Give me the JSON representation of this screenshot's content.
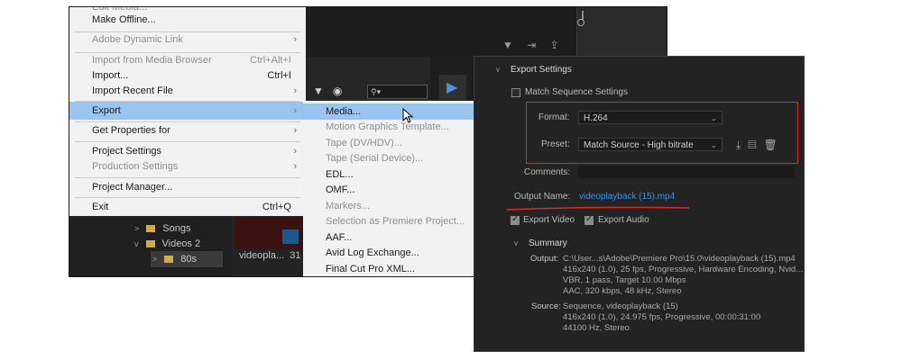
{
  "file_menu": {
    "items": [
      {
        "label": "Edit Media...",
        "shortcut": "",
        "disabled": true
      },
      {
        "label": "Make Offline...",
        "shortcut": "",
        "disabled": false
      },
      {
        "label": "Adobe Dynamic Link",
        "shortcut": "",
        "disabled": true,
        "submenu": true
      },
      {
        "label": "Import from Media Browser",
        "shortcut": "Ctrl+Alt+I",
        "disabled": true
      },
      {
        "label": "Import...",
        "shortcut": "Ctrl+I",
        "disabled": false
      },
      {
        "label": "Import Recent File",
        "shortcut": "",
        "disabled": false,
        "submenu": true
      },
      {
        "label": "Export",
        "shortcut": "",
        "disabled": false,
        "submenu": true,
        "active": true
      },
      {
        "label": "Get Properties for",
        "shortcut": "",
        "disabled": false,
        "submenu": true
      },
      {
        "label": "Project Settings",
        "shortcut": "",
        "disabled": false,
        "submenu": true
      },
      {
        "label": "Production Settings",
        "shortcut": "",
        "disabled": true,
        "submenu": true
      },
      {
        "label": "Project Manager...",
        "shortcut": "",
        "disabled": false
      },
      {
        "label": "Exit",
        "shortcut": "Ctrl+Q",
        "disabled": false
      }
    ],
    "submenu_arrow": "›"
  },
  "export_submenu": {
    "items": [
      {
        "label": "Media...",
        "disabled": false,
        "active": true
      },
      {
        "label": "Motion Graphics Template...",
        "disabled": true
      },
      {
        "label": "Tape (DV/HDV)...",
        "disabled": true
      },
      {
        "label": "Tape (Serial Device)...",
        "disabled": true
      },
      {
        "label": "EDL...",
        "disabled": false
      },
      {
        "label": "OMF...",
        "disabled": false
      },
      {
        "label": "Markers...",
        "disabled": true
      },
      {
        "label": "Selection as Premiere Project...",
        "disabled": true
      },
      {
        "label": "AAF...",
        "disabled": false
      },
      {
        "label": "Avid Log Exchange...",
        "disabled": false
      },
      {
        "label": "Final Cut Pro XML...",
        "disabled": false
      }
    ]
  },
  "project_panel": {
    "bins": [
      {
        "label": "Songs"
      },
      {
        "label": "Videos 2"
      },
      {
        "label": "80s"
      }
    ],
    "clip_label": "videopla...",
    "clip_count": "31"
  },
  "export_settings": {
    "section_title": "Export Settings",
    "match_sequence_label": "Match Sequence Settings",
    "format_label": "Format:",
    "format_value": "H.264",
    "preset_label": "Preset:",
    "preset_value": "Match Source - High bitrate",
    "comments_label": "Comments:",
    "output_name_label": "Output Name:",
    "output_name_value": "videoplayback (15).mp4",
    "export_video_label": "Export Video",
    "export_audio_label": "Export Audio",
    "summary_title": "Summary",
    "output_key": "Output:",
    "output_lines": [
      "C:\\User...s\\Adobe\\Premiere Pro\\15.0\\videoplayback (15).mp4",
      "416x240 (1.0), 25 fps, Progressive, Hardware Encoding, Nvid...",
      "VBR, 1 pass, Target 10.00 Mbps",
      "AAC, 320 kbps, 48 kHz, Stereo"
    ],
    "source_key": "Source:",
    "source_lines": [
      "Sequence, videoplayback (15)",
      "416x240 (1.0), 24.975 fps, Progressive, 00:00:31:00",
      "44100 Hz, Stereo"
    ]
  },
  "colors": {
    "highlight": "#99c5f0",
    "annotation_red": "#d92b2b",
    "link_blue": "#3b8fe6"
  }
}
